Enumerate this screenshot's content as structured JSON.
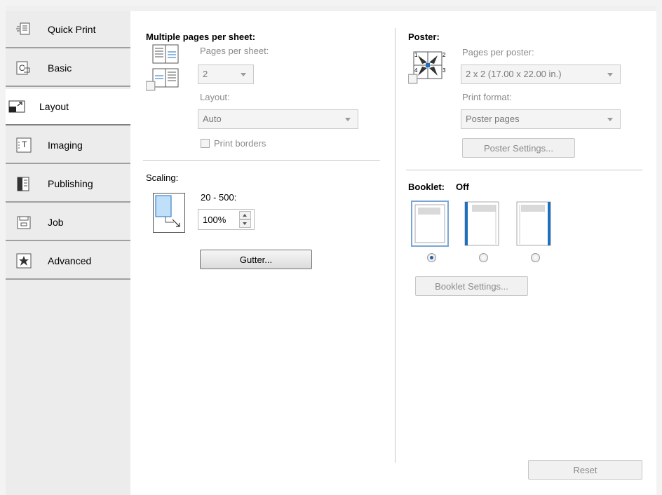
{
  "sidebar": {
    "tabs": [
      {
        "label": "Quick Print",
        "icon": "quick-print-icon",
        "active": false
      },
      {
        "label": "Basic",
        "icon": "basic-icon",
        "active": false
      },
      {
        "label": "Layout",
        "icon": "layout-icon",
        "active": true
      },
      {
        "label": "Imaging",
        "icon": "imaging-icon",
        "active": false
      },
      {
        "label": "Publishing",
        "icon": "publishing-icon",
        "active": false
      },
      {
        "label": "Job",
        "icon": "job-icon",
        "active": false
      },
      {
        "label": "Advanced",
        "icon": "advanced-icon",
        "active": false
      }
    ]
  },
  "multiple_pages": {
    "title": "Multiple pages per sheet:",
    "pages_label": "Pages per sheet:",
    "pages_value": "2",
    "layout_label": "Layout:",
    "layout_value": "Auto",
    "print_borders_label": "Print borders",
    "enabled": false
  },
  "scaling": {
    "title": "Scaling:",
    "range_label": "20 - 500:",
    "value": "100%",
    "gutter_label": "Gutter..."
  },
  "poster": {
    "title": "Poster:",
    "pages_label": "Pages per poster:",
    "pages_value": "2 x 2 (17.00 x 22.00 in.)",
    "format_label": "Print format:",
    "format_value": "Poster pages",
    "settings_label": "Poster Settings...",
    "icon_numbers": [
      "1",
      "2",
      "4",
      "3"
    ],
    "enabled": false
  },
  "booklet": {
    "title": "Booklet:",
    "status": "Off",
    "options": [
      "none",
      "left-binding",
      "right-binding"
    ],
    "selected": 0,
    "settings_label": "Booklet Settings..."
  },
  "footer": {
    "reset_label": "Reset"
  },
  "colors": {
    "accent": "#1f6fbf",
    "disabled_text": "#8a8a8a"
  }
}
